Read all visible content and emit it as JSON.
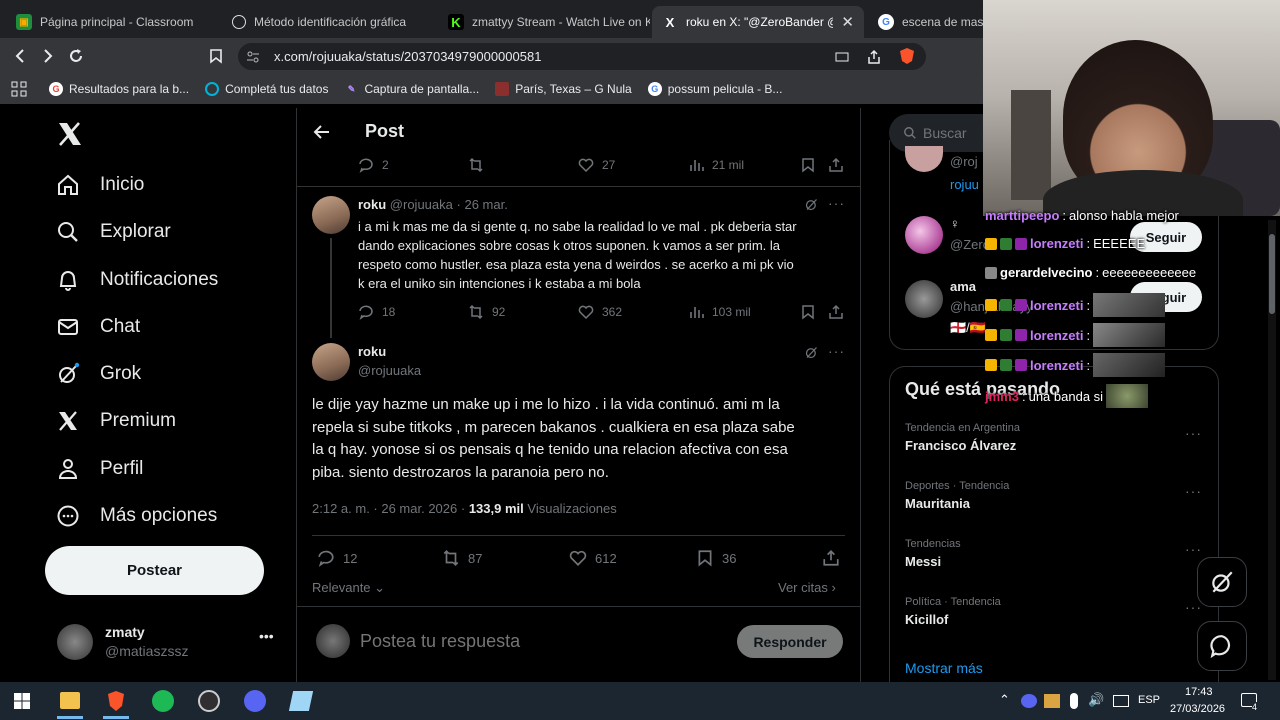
{
  "browser": {
    "tabs": [
      {
        "label": "Página principal - Classroom",
        "icon": "classroom-icon",
        "color": "#f9ab00"
      },
      {
        "label": "Método identificación gráfica",
        "icon": "chatgpt-icon",
        "color": "#ffffff"
      },
      {
        "label": "zmattyy Stream - Watch Live on K",
        "icon": "kick-icon",
        "color": "#53fc18"
      },
      {
        "label": "roku en X: \"@ZeroBander @h",
        "icon": "x-icon",
        "color": "#ffffff"
      },
      {
        "label": "escena de maso",
        "icon": "google-icon",
        "color": "#4285f4"
      }
    ],
    "url": "x.com/rojuuaka/status/2037034979000000581",
    "bookmarks": [
      {
        "label": "Resultados para la b...",
        "icon": "google-icon"
      },
      {
        "label": "Completá tus datos",
        "icon": "circle-icon"
      },
      {
        "label": "Captura de pantalla...",
        "icon": "feather-icon"
      },
      {
        "label": "París, Texas – G Nula",
        "icon": "movie-icon"
      },
      {
        "label": "possum pelicula - B...",
        "icon": "google-icon"
      }
    ]
  },
  "sidebar": {
    "items": [
      {
        "label": "Inicio",
        "icon": "home-icon"
      },
      {
        "label": "Explorar",
        "icon": "search-icon"
      },
      {
        "label": "Notificaciones",
        "icon": "bell-icon"
      },
      {
        "label": "Chat",
        "icon": "mail-icon"
      },
      {
        "label": "Grok",
        "icon": "grok-icon"
      },
      {
        "label": "Premium",
        "icon": "x-icon"
      },
      {
        "label": "Perfil",
        "icon": "person-icon"
      },
      {
        "label": "Más opciones",
        "icon": "more-icon"
      }
    ],
    "post_button": "Postear",
    "account": {
      "name": "zmaty",
      "handle": "@matiaszssz"
    }
  },
  "post": {
    "header": "Post",
    "top_actions": {
      "replies": "2",
      "likes": "27",
      "views": "21 mil"
    },
    "reply": {
      "name": "roku",
      "handle": "@rojuuaka",
      "date": "26 mar.",
      "lines": [
        "i a mi k mas me da si gente q. no sabe la realidad lo ve mal . pk deberia star",
        "dando explicaciones sobre cosas k otros suponen. k vamos a ser prim. la",
        "respeto como hustler. esa plaza esta yena d weirdos . se acerko a mi pk vio",
        "k era el uniko sin intenciones i k estaba a mi bola"
      ],
      "replies": "18",
      "reposts": "92",
      "likes": "362",
      "views": "103 mil"
    },
    "main": {
      "name": "roku",
      "handle": "@rojuuaka",
      "lines": [
        "le dije yay hazme un make up i me lo hizo . i la vida continuó. ami m la",
        "repela si sube titkoks , m parecen bakanos . cualkiera en esa plaza sabe",
        "la q hay. yonose si os pensais q he tenido una relacion afectiva con esa",
        "piba. siento destrozaros la paranoia pero no."
      ],
      "time": "2:12 a. m. · 26 mar. 2026 ·",
      "views_count": "133,9 mil",
      "views_label": "Visualizaciones",
      "replies": "12",
      "reposts": "87",
      "likes": "612",
      "bookmarks": "36"
    },
    "sort_label": "Relevante",
    "quotes_label": "Ver citas",
    "reply_placeholder": "Postea tu respuesta",
    "reply_button": "Responder"
  },
  "right": {
    "search_placeholder": "Buscar",
    "follow_label": "Seguir",
    "who_to_follow": [
      {
        "name": "",
        "handle": "@roj",
        "extra": "rojuu"
      },
      {
        "name": "♀",
        "handle": "@Zero"
      },
      {
        "name": "ama",
        "handle": "@hanjiahuayy",
        "extra": "🏴󠁧󠁢󠁥󠁮󠁧󠁿/🇪🇸"
      }
    ],
    "trends_title": "Qué está pasando",
    "trends": [
      {
        "category": "Tendencia en Argentina",
        "name": "Francisco Álvarez"
      },
      {
        "category": "Deportes · Tendencia",
        "name": "Mauritania"
      },
      {
        "category": "Tendencias",
        "name": "Messi"
      },
      {
        "category": "Política · Tendencia",
        "name": "Kicillof"
      }
    ],
    "show_more": "Mostrar más"
  },
  "stream_chat": [
    {
      "user": "marttipeepo",
      "msg": "alonso habla mejor",
      "color": "#c77dff"
    },
    {
      "user": "lorenzeti",
      "msg": "EEEEEE",
      "color": "#c77dff"
    },
    {
      "user": "gerardelvecino",
      "msg": "eeeeeeeeeeeee",
      "color": "#ffffff"
    },
    {
      "user": "lorenzeti",
      "msg": "",
      "color": "#c77dff"
    },
    {
      "user": "lorenzeti",
      "msg": "",
      "color": "#c77dff"
    },
    {
      "user": "lorenzeti",
      "msg": "",
      "color": "#c77dff"
    },
    {
      "user": "jmm3",
      "msg": "una banda si",
      "color": "#e0245e"
    }
  ],
  "taskbar": {
    "apps": [
      "windows-icon",
      "explorer-icon",
      "brave-icon",
      "spotify-icon",
      "obs-icon",
      "discord-icon",
      "notepad-icon"
    ],
    "lang": "ESP",
    "time": "17:43",
    "date": "27/03/2026",
    "notifications": "4"
  },
  "colors": {
    "accent": "#1d9bf0",
    "bg": "#000000",
    "border": "#2f3336",
    "muted": "#71767b"
  }
}
